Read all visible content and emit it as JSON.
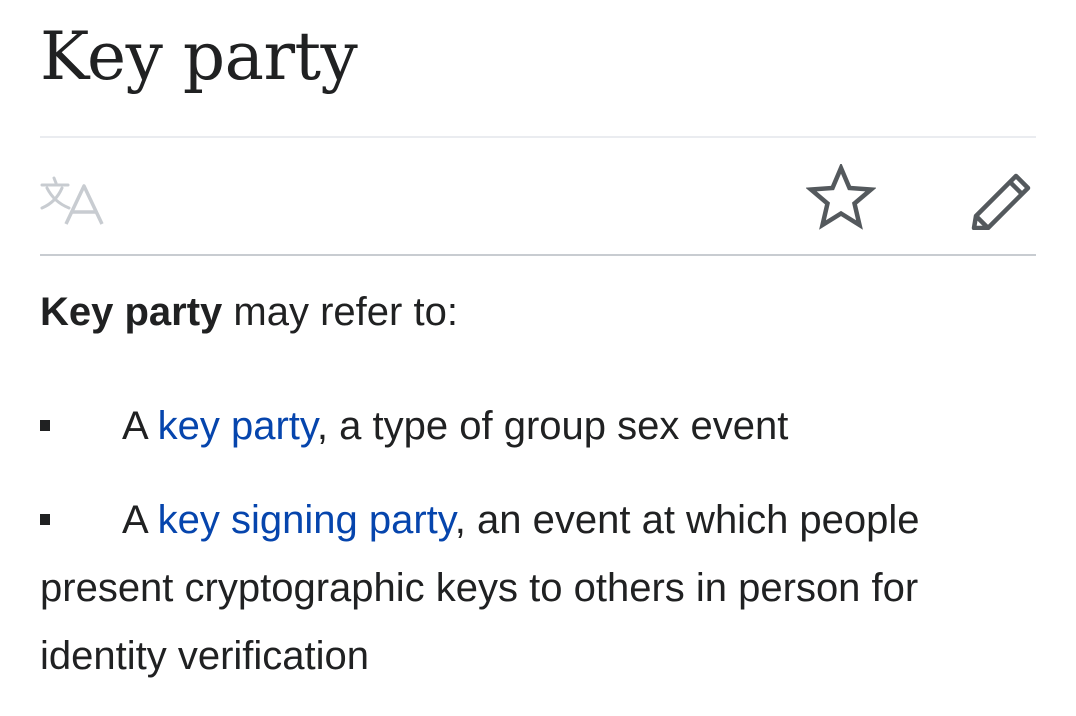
{
  "page": {
    "title": "Key party"
  },
  "toolbar": {
    "language_icon": "translate-icon",
    "watch_icon": "star-icon",
    "edit_icon": "pencil-icon"
  },
  "intro": {
    "bold": "Key party",
    "rest": " may refer to:"
  },
  "items": [
    {
      "prefix": "A ",
      "link": "key party",
      "suffix": ", a type of group sex event"
    },
    {
      "prefix": "A ",
      "link": "key signing party",
      "suffix": ", an event at which people present cryptographic keys to others in person for identity verification"
    }
  ],
  "colors": {
    "link": "#0645ad",
    "text": "#202122",
    "icon": "#54595d",
    "icon_disabled": "#c8ccd1"
  }
}
